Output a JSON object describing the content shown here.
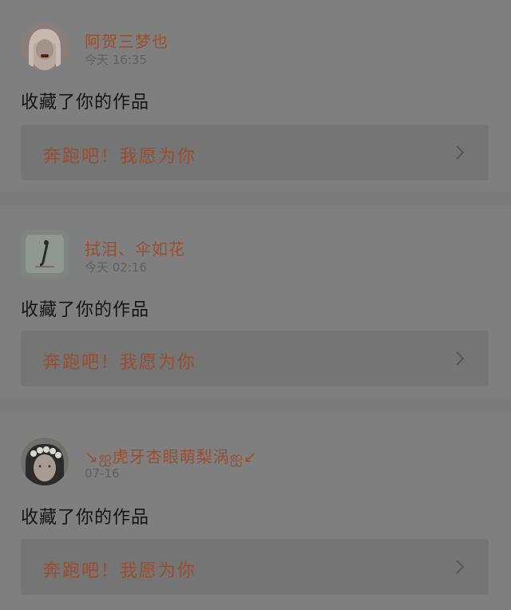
{
  "notifications": [
    {
      "username": "阿贺三梦也",
      "timestamp": "今天 16:35",
      "action": "收藏了你的作品",
      "work_title": "奔跑吧！我愿为你"
    },
    {
      "username": "拭泪、伞如花",
      "timestamp": "今天 02:16",
      "action": "收藏了你的作品",
      "work_title": "奔跑吧！我愿为你"
    },
    {
      "username": "↘ஐ虎牙杏眼萌梨涡ஐ↙",
      "timestamp": "07-16",
      "action": "收藏了你的作品",
      "work_title": "奔跑吧！我愿为你"
    }
  ],
  "colors": {
    "accent": "#9a4d2e",
    "background": "#7b7b7b",
    "card": "#7f7f7f",
    "link_box": "#757575"
  },
  "icons": {
    "chevron": "chevron-right-icon"
  }
}
